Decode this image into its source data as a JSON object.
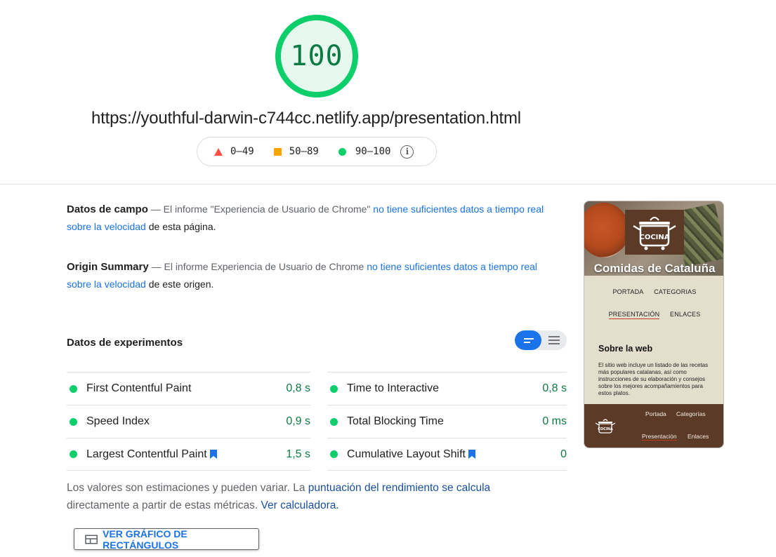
{
  "score": {
    "value": "100",
    "fraction": 1.0,
    "color": "#0cce6b",
    "fill": "#e7f8ee",
    "text_color": "#0c7a43"
  },
  "url": "https://youthful-darwin-c744cc.netlify.app/presentation.html",
  "legend": {
    "fail": "0–49",
    "average": "50–89",
    "pass": "90–100",
    "info_icon": "info-icon"
  },
  "field_data": {
    "title": "Datos de campo",
    "dash_text": "— El informe \"Experiencia de Usuario de Chrome\"",
    "link": "no tiene suficientes datos a tiempo real sobre la velocidad",
    "rest": "de esta página."
  },
  "origin_summary": {
    "title": "Origin Summary",
    "dash_text": "— El informe Experiencia de Usuario de Chrome",
    "link": "no tiene suficientes datos a tiempo real sobre la velocidad",
    "rest": "de este origen."
  },
  "experiments": {
    "title": "Datos de experimentos",
    "metrics_left": [
      {
        "name": "First Contentful Paint",
        "value": "0,8 s",
        "bookmark": false
      },
      {
        "name": "Speed Index",
        "value": "0,9 s",
        "bookmark": false
      },
      {
        "name": "Largest Contentful Paint",
        "value": "1,5 s",
        "bookmark": true
      }
    ],
    "metrics_right": [
      {
        "name": "Time to Interactive",
        "value": "0,8 s",
        "bookmark": false
      },
      {
        "name": "Total Blocking Time",
        "value": "0 ms",
        "bookmark": false
      },
      {
        "name": "Cumulative Layout Shift",
        "value": "0",
        "bookmark": true
      }
    ]
  },
  "note": {
    "text1": "Los valores son estimaciones y pueden variar. La",
    "link1": "puntuación del rendimiento se calcula",
    "text2": "directamente a partir de estas métricas.",
    "link2": "Ver calculadora."
  },
  "treemap_button": "VER GRÁFICO DE RECTÁNGULOS",
  "screenshot": {
    "logo_text": "COCINA",
    "site_title": "Comidas de Cataluña",
    "nav_row1": [
      "PORTADA",
      "CATEGORIAS"
    ],
    "nav_row2": [
      "PRESENTACIÓN",
      "ENLACES"
    ],
    "heading": "Sobre la web",
    "paragraph": "El sitio web incluye un listado de las recetas más populares catalanas, así como instrucciones de su elaboración y consejos sobre los mejores acompañamientos para estos platos.",
    "footer_links": [
      "Portada",
      "Categorías",
      "Presentación",
      "Enlaces"
    ]
  }
}
